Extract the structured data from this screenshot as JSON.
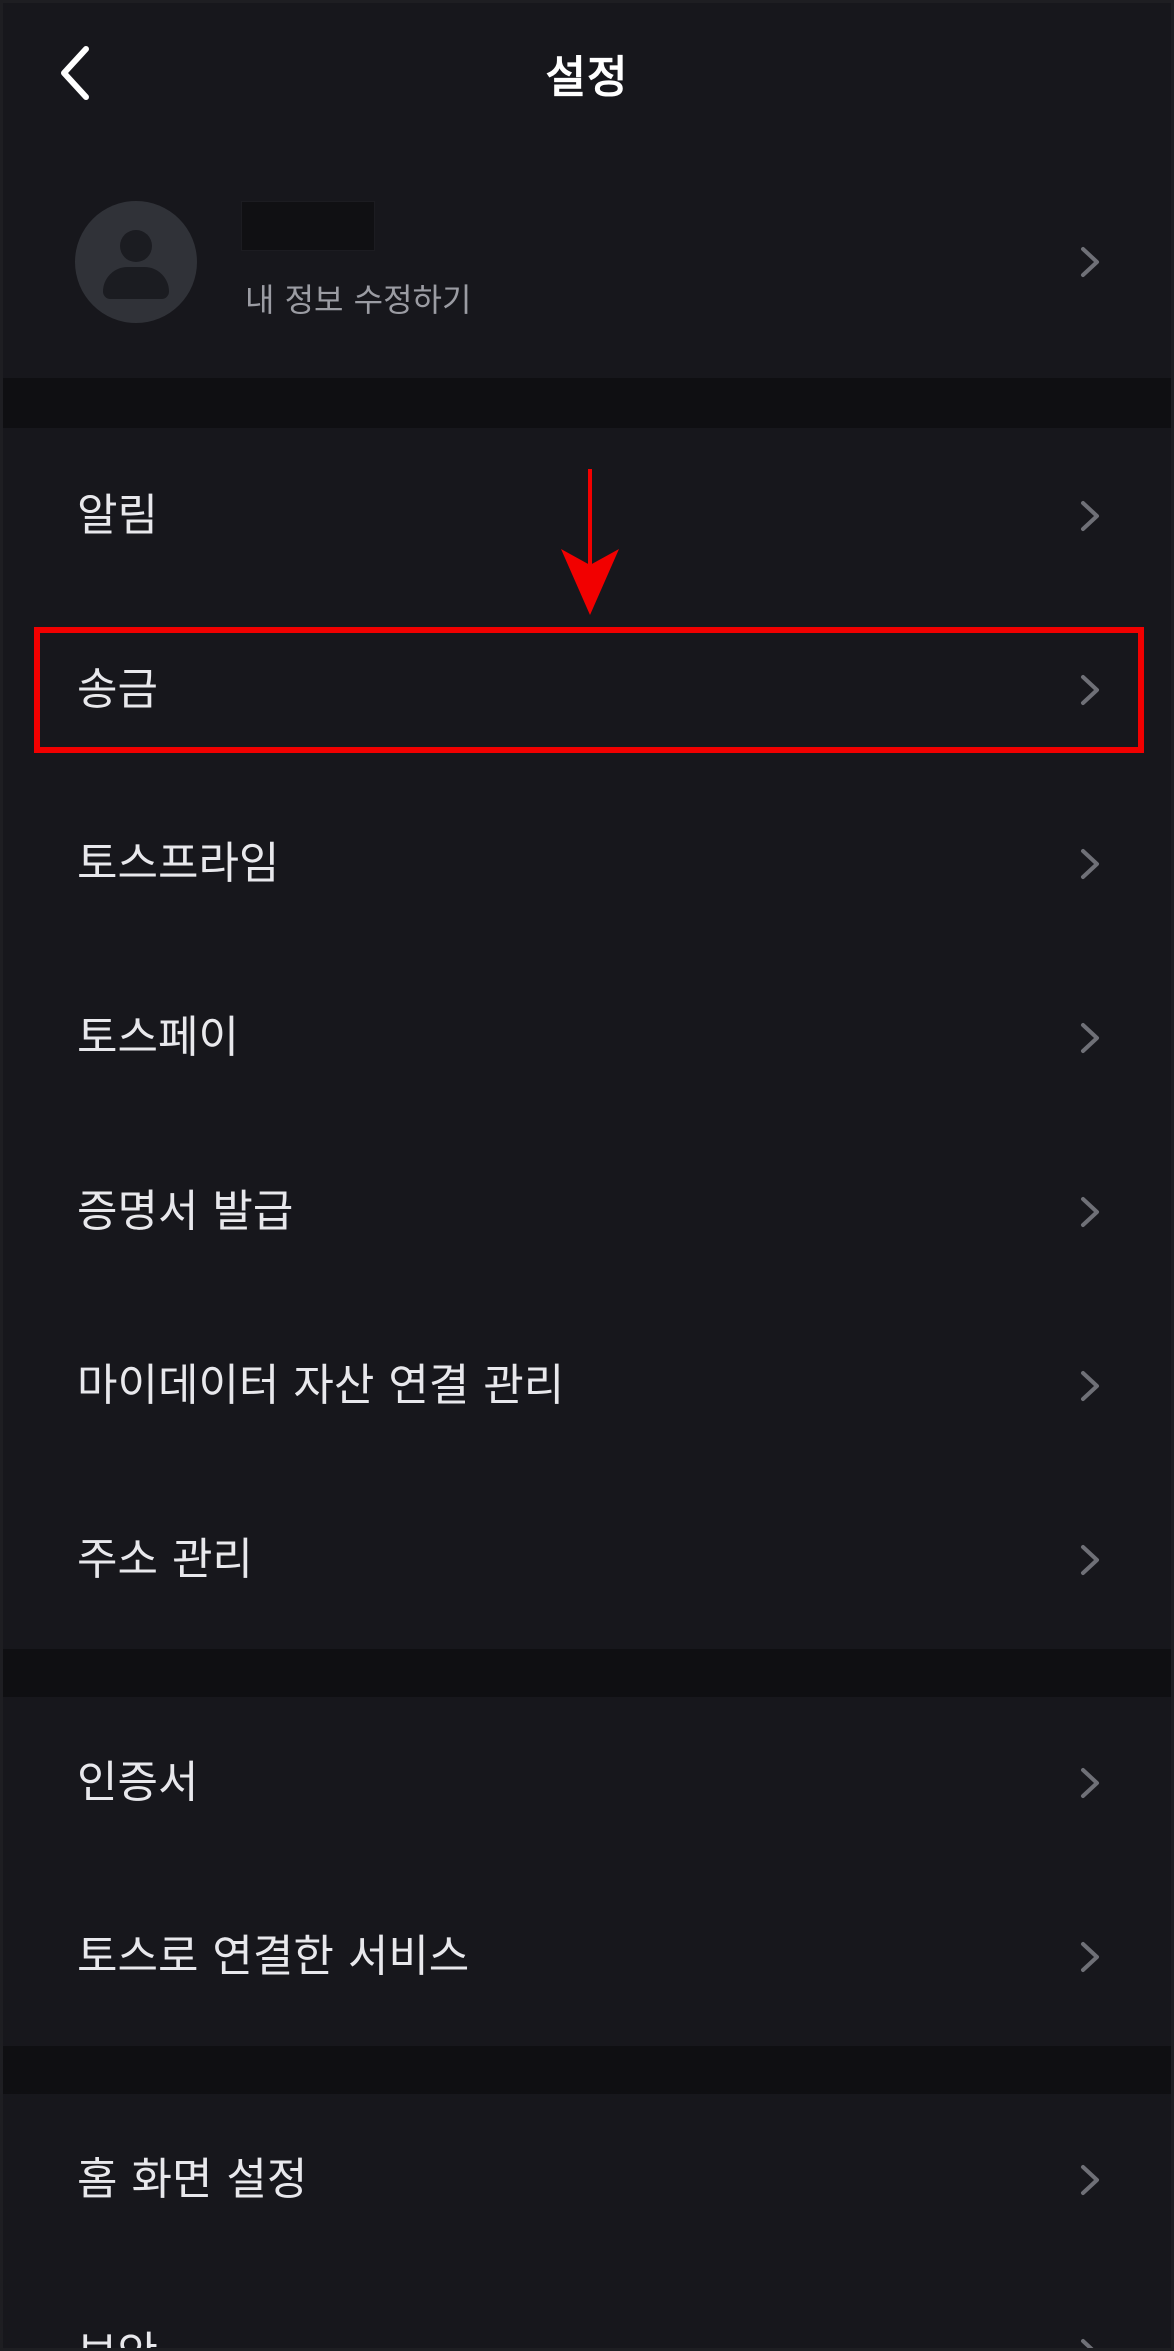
{
  "header": {
    "title": "설정",
    "back_icon": "chevron-left-icon"
  },
  "profile": {
    "avatar_icon": "person-icon",
    "name": "",
    "edit_label": "내 정보 수정하기"
  },
  "menu": {
    "items": [
      {
        "label": "알림"
      },
      {
        "label": "송금"
      },
      {
        "label": "토스프라임"
      },
      {
        "label": "토스페이"
      },
      {
        "label": "증명서 발급"
      },
      {
        "label": "마이데이터 자산 연결 관리"
      },
      {
        "label": "주소 관리"
      },
      {
        "label": "인증서"
      },
      {
        "label": "토스로 연결한 서비스"
      },
      {
        "label": "홈 화면 설정"
      },
      {
        "label": "보안"
      }
    ]
  },
  "annotation": {
    "highlight_color": "#f20000",
    "arrow_color": "#f20000"
  },
  "colors": {
    "background": "#17171c",
    "section_gap": "#0f0f12",
    "text_primary": "#e8e8ec",
    "text_secondary": "#9b9ca3",
    "chevron": "#6f7077"
  }
}
